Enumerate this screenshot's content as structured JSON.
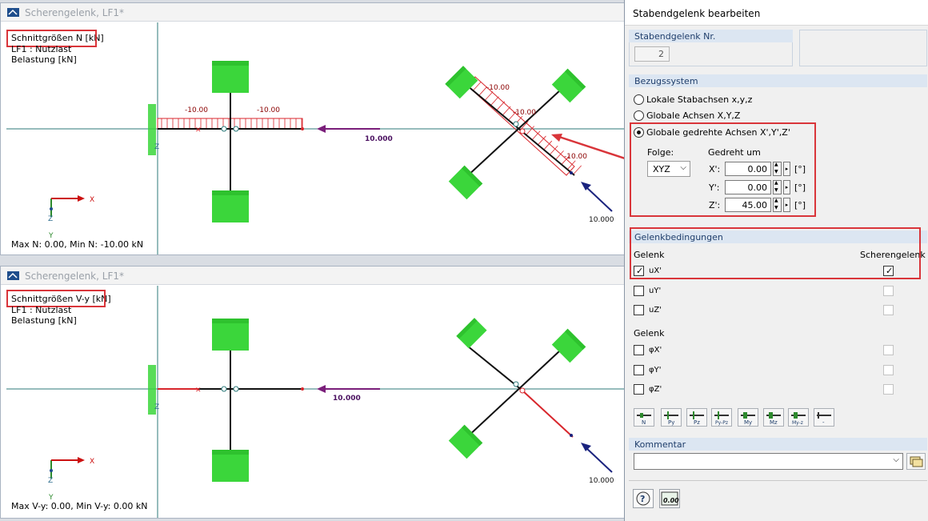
{
  "windows": [
    {
      "title": "Scherengelenk, LF1*",
      "result_title": "Schnittgrößen N [kN]",
      "case_line": "LF1 : Nutzlast",
      "load_line": "Belastung [kN]",
      "summary": "Max N: 0.00, Min N: -10.00 kN",
      "show_diagram": true
    },
    {
      "title": "Scherengelenk, LF1*",
      "result_title": "Schnittgrößen V-y [kN]",
      "case_line": "LF1 : Nutzlast",
      "load_line": "Belastung [kN]",
      "summary": "Max V-y: 0.00, Min V-y: 0.00 kN",
      "show_diagram": false
    }
  ],
  "model_labels": {
    "horizontal_diagram_values": [
      "-10.00",
      "-10.00"
    ],
    "rotated_diagram_values": [
      "-10.00",
      "-10.00",
      "-10.00"
    ],
    "load_horizontal": "10.000",
    "load_diagonal": "10.000",
    "axis_x": "X",
    "axis_z": "Z",
    "axis_y": "Y",
    "member_end_x": "X"
  },
  "colors": {
    "support": "#3bd63b",
    "diagram": "#d8262c",
    "load_horizontal": "#7a1e7a",
    "load_diagonal": "#1a237e",
    "highlight": "#d9353a",
    "axis_x": "#cc1111",
    "axis_z": "#2d8a2d"
  },
  "dialog": {
    "title": "Stabendgelenk bearbeiten",
    "hinge_no_header": "Stabendgelenk Nr.",
    "hinge_no": "2",
    "reference_header": "Bezugssystem",
    "options": [
      {
        "label": "Lokale Stabachsen x,y,z",
        "selected": false
      },
      {
        "label": "Globale Achsen X,Y,Z",
        "selected": false
      },
      {
        "label": "Globale gedrehte Achsen X',Y',Z'",
        "selected": true
      }
    ],
    "sequence_label": "Folge:",
    "sequence_value": "XYZ",
    "rotated_label": "Gedreht um",
    "rotations": [
      {
        "axis": "X':",
        "value": "0.00",
        "unit": "[°]"
      },
      {
        "axis": "Y':",
        "value": "0.00",
        "unit": "[°]"
      },
      {
        "axis": "Z':",
        "value": "45.00",
        "unit": "[°]"
      }
    ],
    "conditions_header": "Gelenkbedingungen",
    "hinge_col": "Gelenk",
    "shear_col": "Scherengelenk",
    "translations": [
      {
        "label": "uX'",
        "hinge": true,
        "shear": true
      },
      {
        "label": "uY'",
        "hinge": false,
        "shear": false
      },
      {
        "label": "uZ'",
        "hinge": false,
        "shear": false
      }
    ],
    "rotation_hinge_col": "Gelenk",
    "rotations_hinge": [
      {
        "label": "φX'",
        "hinge": false,
        "shear": false
      },
      {
        "label": "φY'",
        "hinge": false,
        "shear": false
      },
      {
        "label": "φZ'",
        "hinge": false,
        "shear": false
      }
    ],
    "toolbar_labels": [
      "N",
      "Py",
      "Pz",
      "Py-Pz",
      "My",
      "Mz",
      "My-z",
      "-"
    ],
    "comment_header": "Kommentar",
    "comment_value": "",
    "units_button_text": "0.00"
  }
}
